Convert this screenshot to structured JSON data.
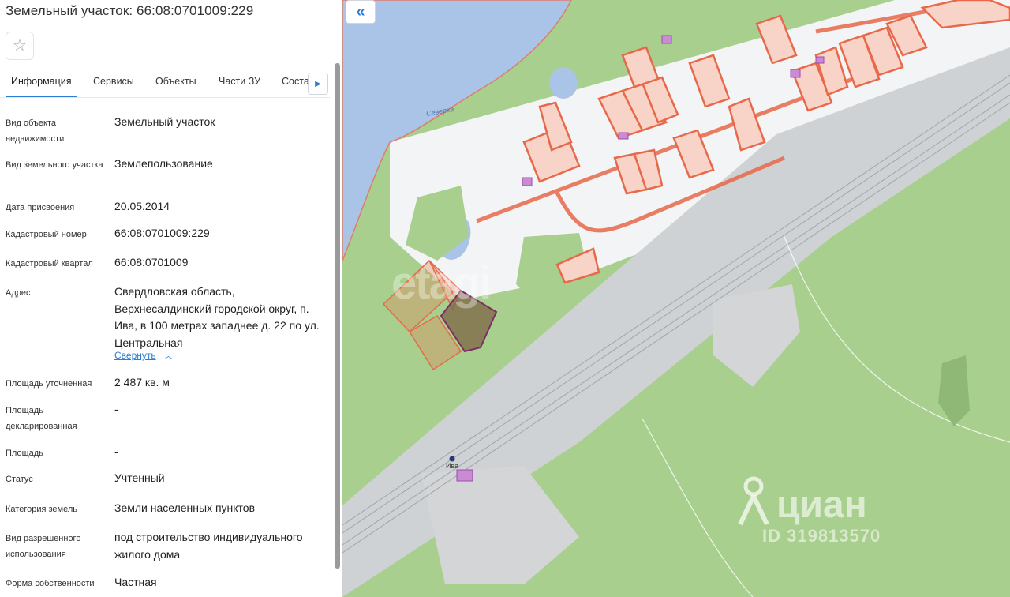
{
  "panel": {
    "title": "Земельный участок: 66:08:0701009:229",
    "tabs": [
      "Информация",
      "Сервисы",
      "Объекты",
      "Части ЗУ",
      "Соста"
    ],
    "collapse_label": "Свернуть",
    "rows": [
      {
        "label": "Вид объекта недвижимости",
        "value": "Земельный участок"
      },
      {
        "label": "Вид земельного участка",
        "value": "Землепользование"
      },
      {
        "label": "Дата присвоения",
        "value": "20.05.2014"
      },
      {
        "label": "Кадастровый номер",
        "value": "66:08:0701009:229"
      },
      {
        "label": "Кадастровый квартал",
        "value": "66:08:0701009"
      },
      {
        "label": "Адрес",
        "value": "Свердловская область, Верхнесалдинский городской округ, п. Ива, в 100 метрах западнее д. 22 по ул. Центральная"
      },
      {
        "label": "Площадь уточненная",
        "value": "2 487 кв. м"
      },
      {
        "label": "Площадь декларированная",
        "value": "-"
      },
      {
        "label": "Площадь",
        "value": "-"
      },
      {
        "label": "Статус",
        "value": "Учтенный"
      },
      {
        "label": "Категория земель",
        "value": "Земли населенных пунктов"
      },
      {
        "label": "Вид разрешенного использования",
        "value": "под строительство индивидуального жилого дома"
      },
      {
        "label": "Форма собственности",
        "value": "Частная"
      }
    ]
  },
  "map": {
    "river_label": "Северка",
    "station_label": "Ива",
    "watermark_etagi": "etagi",
    "watermark_cian": "циан",
    "watermark_id": "ID 319813570",
    "colors": {
      "water": "#a9c4e6",
      "forest": "#a8cf8e",
      "residential": "#f3f4f5",
      "rail_area": "#cfd2d4",
      "parcel_outline": "#e8694a",
      "parcel_fill": "#f7d3c8",
      "selected_parcel": "#7c2f66"
    }
  }
}
